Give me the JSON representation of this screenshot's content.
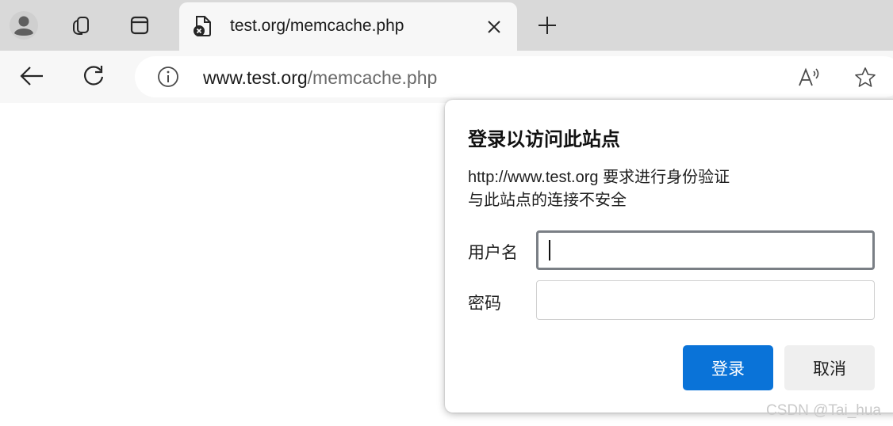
{
  "tabstrip": {
    "icons": [
      "profile-icon",
      "workspaces-icon",
      "tab-actions-icon"
    ],
    "active_tab": {
      "title": "test.org/memcache.php",
      "favicon": "insecure-page-icon",
      "close_icon": "close-icon"
    },
    "new_tab_icon": "plus-icon"
  },
  "toolbar": {
    "back_icon": "back-arrow-icon",
    "refresh_icon": "refresh-icon",
    "site_info_icon": "info-icon",
    "url_host": "www.test.org",
    "url_path": "/memcache.php",
    "read_aloud_icon": "read-aloud-icon",
    "favorite_icon": "star-icon"
  },
  "dialog": {
    "title": "登录以访问此站点",
    "line1": "http://www.test.org 要求进行身份验证",
    "line2": "与此站点的连接不安全",
    "username_label": "用户名",
    "username_value": "",
    "password_label": "密码",
    "password_value": "",
    "login_label": "登录",
    "cancel_label": "取消"
  },
  "watermark": "CSDN @Tai_hua",
  "colors": {
    "primary": "#0a73d8",
    "tabstrip_bg": "#d9d9d9",
    "toolbar_bg": "#f7f7f7"
  }
}
